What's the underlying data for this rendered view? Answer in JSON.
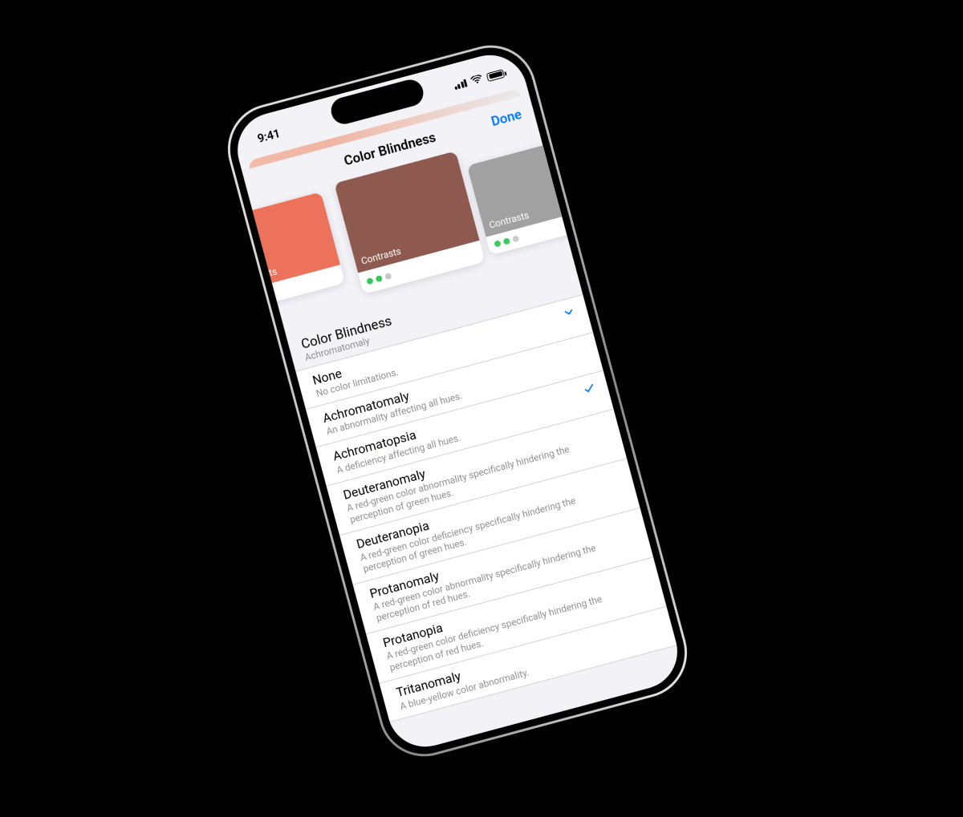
{
  "statusbar": {
    "time": "9:41"
  },
  "nav": {
    "title": "Color Blindness",
    "done": "Done"
  },
  "cards": {
    "left_label": "Contrasts",
    "center_label": "Contrasts",
    "right_label": "Contrasts",
    "colors": {
      "left": "#ed6b53",
      "center": "#8e5a50",
      "right": "#9c9c9c"
    }
  },
  "section": {
    "title": "Color Blindness",
    "subtitle": "Achromatomaly"
  },
  "options": [
    {
      "title": "None",
      "sub": "No color limitations.",
      "selected": true,
      "chevron": true
    },
    {
      "title": "Achromatomaly",
      "sub": "An abnormality affecting all hues.",
      "selected": false
    },
    {
      "title": "Achromatopsia",
      "sub": "A deficiency affecting all hues.",
      "selected": true
    },
    {
      "title": "Deuteranomaly",
      "sub": "A red-green color abnormality specifically hindering the perception of green hues.",
      "selected": false
    },
    {
      "title": "Deuteranopia",
      "sub": "A red-green color deficiency specifically hindering the perception of green hues.",
      "selected": false
    },
    {
      "title": "Protanomaly",
      "sub": "A red-green color abnormality specifically hindering the perception of red hues.",
      "selected": false
    },
    {
      "title": "Protanopia",
      "sub": "A red-green color deficiency specifically hindering the perception of red hues.",
      "selected": false
    },
    {
      "title": "Tritanomaly",
      "sub": "A blue-yellow color abnormality.",
      "selected": false
    }
  ],
  "accent": "#007aff"
}
